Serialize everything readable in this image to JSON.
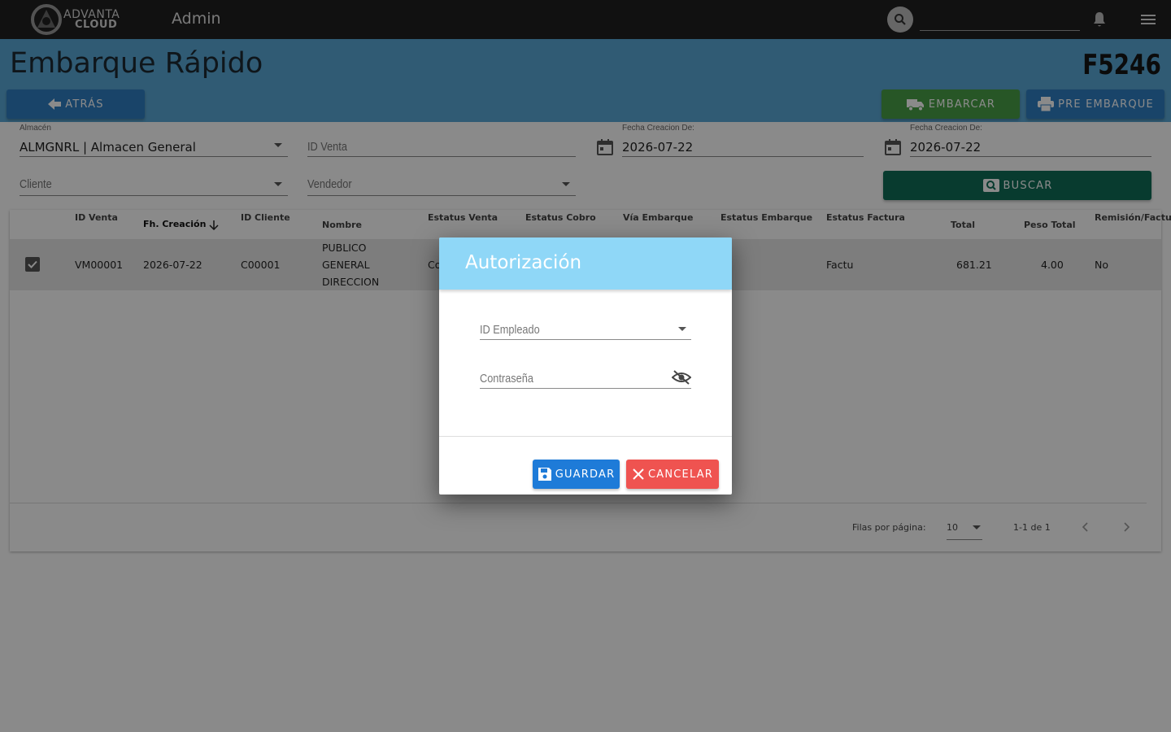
{
  "topbar": {
    "logo_line1": "ADVANTA",
    "logo_line2": "CLOUD",
    "title": "Admin",
    "search_placeholder": ""
  },
  "header": {
    "title": "Embarque Rápido",
    "folio": "F5246",
    "back_label": "ATRÁS",
    "ship_label": "EMBARCAR",
    "pre_ship_label": "PRE EMBARQUE"
  },
  "filters": {
    "almacen_label": "Almacén",
    "almacen_value": "ALMGNRL | Almacen General",
    "id_venta_placeholder": "ID Venta",
    "fecha1_label": "Fecha Creacion De:",
    "fecha1_value": "2026-07-22",
    "fecha2_label": "Fecha Creacion De:",
    "fecha2_value": "2026-07-22",
    "cliente_placeholder": "Cliente",
    "vendedor_placeholder": "Vendedor",
    "search_label": "BUSCAR"
  },
  "table": {
    "headers": [
      "ID Venta",
      "Fh. Creación",
      "ID Cliente",
      "Nombre",
      "Estatus Venta",
      "Estatus Cobro",
      "Vía Embarque",
      "Estatus Embarque",
      "Estatus Factura",
      "Total",
      "Peso Total",
      "Remisión/Factu"
    ],
    "rows": [
      {
        "id_venta": "VM00001",
        "fecha": "2026-07-22",
        "id_cliente": "C00001",
        "nombre_1": "PUBLICO",
        "nombre_2": "GENERAL",
        "nombre_3": "DIRECCION",
        "estatus_venta": "Co",
        "estatus_factura": "Factu",
        "total": "681.21",
        "peso": "4.00",
        "remision": "No"
      }
    ],
    "rows_per_page_label": "Filas por página:",
    "rows_per_page": "10",
    "page_info": "1-1 de 1"
  },
  "dialog": {
    "title": "Autorización",
    "employee_placeholder": "ID Empleado",
    "password_placeholder": "Contraseña",
    "save_label": "GUARDAR",
    "cancel_label": "CANCELAR"
  },
  "colors": {
    "topbar": "#212121",
    "band": "#5aa8d6",
    "primary": "#2f7fc3",
    "success": "#48a047",
    "search": "#0f6e58",
    "dialog_header": "#8fd7f7",
    "danger": "#ef5350"
  }
}
